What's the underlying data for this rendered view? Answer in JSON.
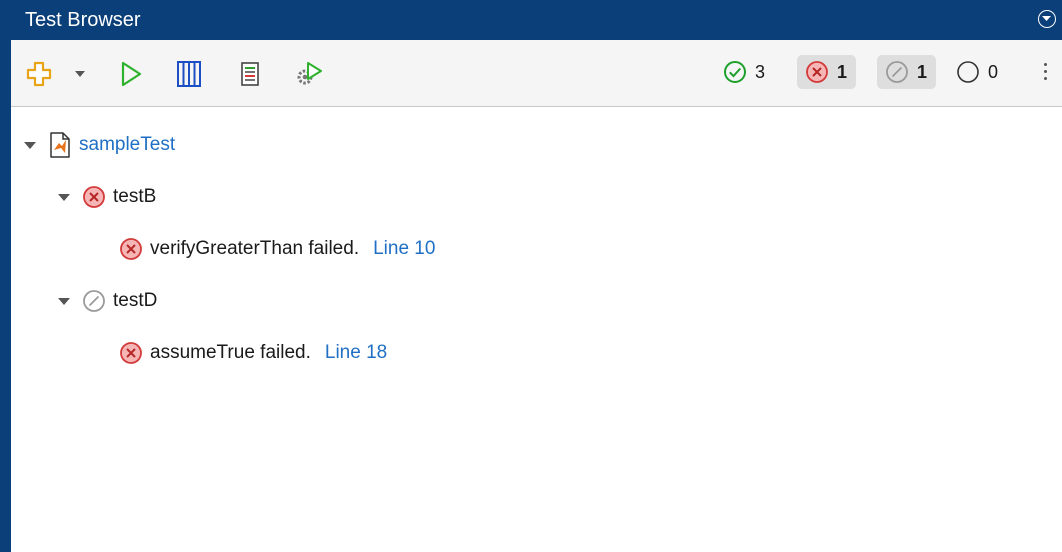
{
  "window": {
    "title": "Test Browser"
  },
  "toolbar": {
    "filters": {
      "passed": {
        "count": "3"
      },
      "failed": {
        "count": "1"
      },
      "incomplete": {
        "count": "1"
      },
      "notrun": {
        "count": "0"
      }
    }
  },
  "tree": {
    "file": {
      "label": "sampleTest"
    },
    "tests": [
      {
        "name": "testB",
        "status": "failed",
        "diagnostic": {
          "message": "verifyGreaterThan failed.",
          "link": "Line 10"
        }
      },
      {
        "name": "testD",
        "status": "incomplete",
        "diagnostic": {
          "message": "assumeTrue failed.",
          "link": "Line 18"
        }
      }
    ]
  },
  "colors": {
    "titlebar": "#0a3f79",
    "pass": "#1ea02b",
    "fail": "#d33a3a",
    "fail_fill": "#f7b6b6",
    "incomplete": "#9a9a9a",
    "link": "#1f6fc5"
  }
}
